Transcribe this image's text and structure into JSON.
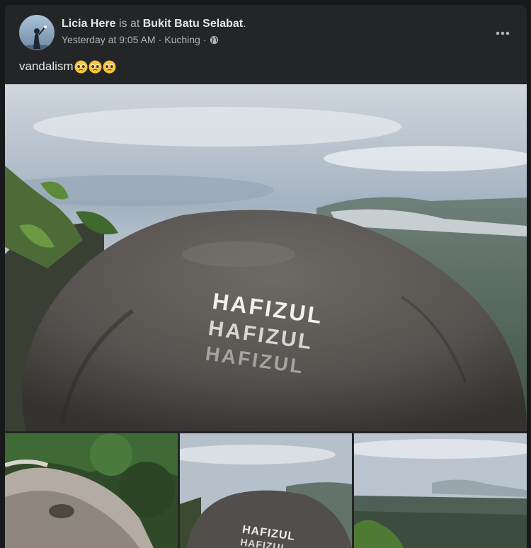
{
  "post": {
    "author": "Licia Here",
    "is_at": "is at",
    "location": "Bukit Batu Selabat",
    "period": ".",
    "timestamp": "Yesterday at 9:05 AM",
    "separator": "·",
    "place": "Kuching",
    "separator2": "·",
    "privacy_icon": "globe-icon",
    "caption": "vandalism",
    "caption_emojis": [
      "pleading-face",
      "pleading-face",
      "pleading-face"
    ],
    "menu_icon": "more-horizontal-icon"
  },
  "photos": {
    "main_text_1": "HAFIZUL",
    "main_text_2": "HAFIZUL",
    "main_text_3": "HAFIZUL",
    "thumb2_text_1": "HAFIZUL",
    "thumb2_text_2": "HAFIZUL"
  },
  "colors": {
    "card_bg": "#242526",
    "page_bg": "#18191a",
    "primary_text": "#e4e6eb",
    "secondary_text": "#b0b3b8"
  }
}
